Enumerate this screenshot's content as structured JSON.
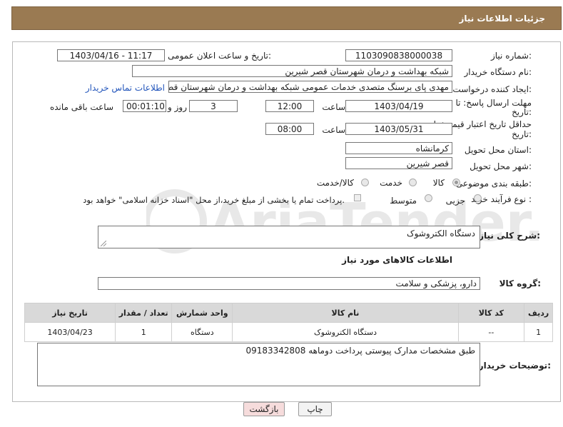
{
  "header": {
    "title": "جزئیات اطلاعات نیاز"
  },
  "form": {
    "need_number_label": "شماره نیاز:",
    "need_number": "1103090838000038",
    "announce_label": "تاریخ و ساعت اعلان عمومی:",
    "announce_value": "1403/04/16 - 11:17",
    "buyer_org_label": "نام دستگاه خریدار:",
    "buyer_org": "شبکه بهداشت و درمان شهرستان قصر شیرین",
    "creator_label": "ایجاد کننده درخواست:",
    "creator": "مهدی پای برسنگ متصدی خدمات عمومی شبکه بهداشت و درمان شهرستان قصر شیرین",
    "contact_link": "اطلاعات تماس خریدار",
    "deadline_label_1": "مهلت ارسال پاسخ: تا",
    "deadline_label_2": "تاریخ:",
    "deadline_date": "1403/04/19",
    "time_label": "ساعت",
    "deadline_time": "12:00",
    "days_value": "3",
    "days_label": "روز و",
    "remaining_time": "00:01:10",
    "remaining_label": "ساعت باقی مانده",
    "validity_label_1": "حداقل تاریخ اعتبار قیمت: تا",
    "validity_label_2": "تاریخ:",
    "validity_date": "1403/05/31",
    "validity_time_label": "ساعت",
    "validity_time": "08:00",
    "province_label": "استان محل تحویل:",
    "province": "کرمانشاه",
    "city_label": "شهر محل تحویل:",
    "city": "قصر شیرین",
    "category_label": "طبقه بندی موضوعی:",
    "category_options": [
      "کالا",
      "خدمت",
      "کالا/خدمت"
    ],
    "process_label": "نوع فرآیند خرید :",
    "process_options": [
      "جزیی",
      "متوسط"
    ],
    "payment_note": "پرداخت تمام یا بخشی از مبلغ خرید،از محل \"اسناد خزانه اسلامی\" خواهد بود."
  },
  "description": {
    "label": "شرح کلی نیاز:",
    "value": "دستگاه الکتروشوک"
  },
  "goods_section": {
    "title": "اطلاعات کالاهای مورد نیاز",
    "group_label": "گروه کالا:",
    "group_value": "دارو، پزشکی و سلامت"
  },
  "table": {
    "headers": [
      "ردیف",
      "کد کالا",
      "نام کالا",
      "واحد شمارش",
      "تعداد / مقدار",
      "تاریخ نیاز"
    ],
    "rows": [
      [
        "1",
        "--",
        "دستگاه الکتروشوک",
        "دستگاه",
        "1",
        "1403/04/23"
      ]
    ]
  },
  "buyer_notes": {
    "label": "توضیحات خریدار:",
    "value": "طبق مشخصات مدارک پیوستی پرداخت دوماهه 09183342808"
  },
  "buttons": {
    "print": "چاپ",
    "back": "بازگشت"
  },
  "watermark": "AriaTender.neT",
  "colors": {
    "title_bar": "#9a7a52",
    "back_button": "#f6dcdc",
    "print_button": "#f3f3f3",
    "table_header": "#d9d9d9"
  }
}
